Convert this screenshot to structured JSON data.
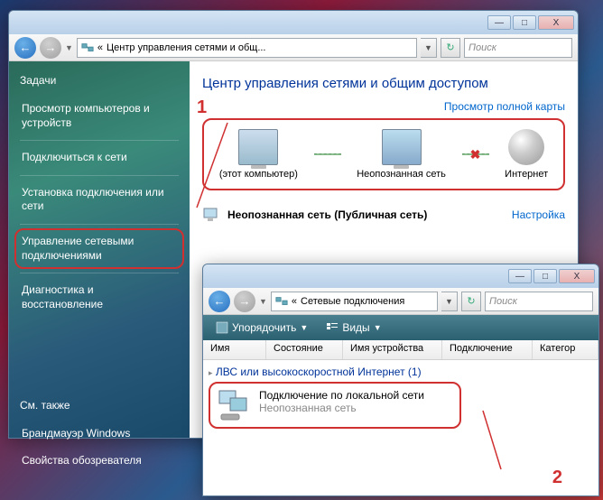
{
  "window1": {
    "breadcrumb_prefix": "«",
    "breadcrumb": "Центр управления сетями и общ...",
    "search_placeholder": "Поиск",
    "title": "Центр управления сетями и общим доступом",
    "map_link": "Просмотр полной карты",
    "sidebar": {
      "header": "Задачи",
      "items": [
        "Просмотр компьютеров и устройств",
        "Подключиться к сети",
        "Установка подключения или сети",
        "Управление сетевыми подключениями",
        "Диагностика и восстановление"
      ],
      "see_also": "См. также",
      "lower_items": [
        "Брандмауэр Windows",
        "Свойства обозревателя"
      ]
    },
    "nodes": {
      "computer": "(этот компьютер)",
      "network": "Неопознанная сеть",
      "internet": "Интернет"
    },
    "netstatus": {
      "name": "Неопознанная сеть (Публичная сеть)",
      "config": "Настройка"
    }
  },
  "window2": {
    "breadcrumb_prefix": "«",
    "breadcrumb": "Сетевые подключения",
    "search_placeholder": "Поиск",
    "toolbar": {
      "organize": "Упорядочить",
      "views": "Виды"
    },
    "columns": [
      "Имя",
      "Состояние",
      "Имя устройства",
      "Подключение",
      "Категор"
    ],
    "group": "ЛВС или высокоскоростной Интернет (1)",
    "connection": {
      "name": "Подключение по локальной сети",
      "status": "Неопознанная сеть"
    }
  },
  "annotations": {
    "one": "1",
    "two": "2"
  },
  "buttons": {
    "min": "—",
    "max": "□",
    "close": "X",
    "back": "←",
    "fwd": "→",
    "refresh": "↻",
    "drop": "▼",
    "chev": "▸"
  }
}
